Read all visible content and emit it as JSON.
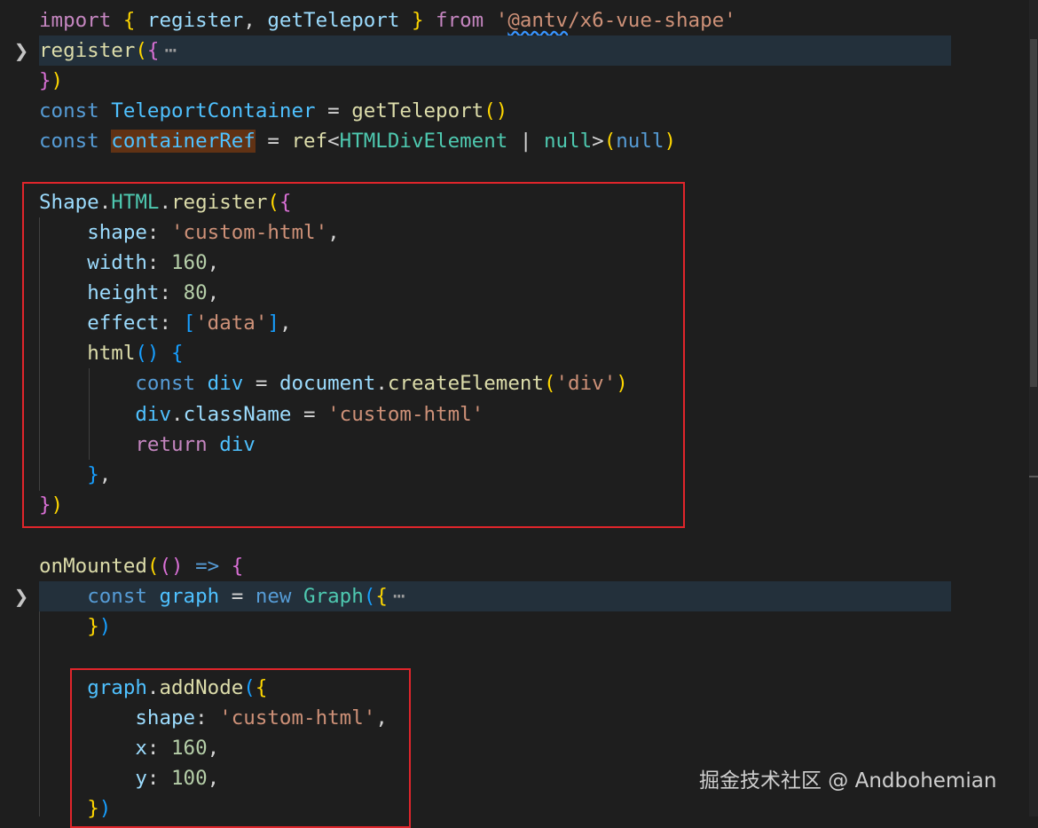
{
  "editor": {
    "fold_ellipsis": "⋯",
    "code_lines": [
      [
        {
          "t": "import",
          "c": "kw"
        },
        {
          "t": " "
        },
        {
          "t": "{",
          "c": "b1"
        },
        {
          "t": " "
        },
        {
          "t": "register",
          "c": "var"
        },
        {
          "t": ", "
        },
        {
          "t": "getTeleport",
          "c": "var"
        },
        {
          "t": " "
        },
        {
          "t": "}",
          "c": "b1"
        },
        {
          "t": " "
        },
        {
          "t": "from",
          "c": "kw"
        },
        {
          "t": " "
        },
        {
          "t": "'",
          "c": "str"
        },
        {
          "t": "@antv",
          "c": "str",
          "sq": true
        },
        {
          "t": "/x6-vue-shape'",
          "c": "str"
        }
      ],
      [
        {
          "t": "register",
          "c": "fn"
        },
        {
          "t": "(",
          "c": "b1"
        },
        {
          "t": "{",
          "c": "b2"
        }
      ],
      [
        {
          "t": "}",
          "c": "b2"
        },
        {
          "t": ")",
          "c": "b1"
        }
      ],
      [
        {
          "t": "const",
          "c": "kwb"
        },
        {
          "t": " "
        },
        {
          "t": "TeleportContainer",
          "c": "cst"
        },
        {
          "t": " = "
        },
        {
          "t": "getTeleport",
          "c": "fn"
        },
        {
          "t": "(",
          "c": "b1"
        },
        {
          "t": ")",
          "c": "b1"
        }
      ],
      [
        {
          "t": "const",
          "c": "kwb"
        },
        {
          "t": " "
        },
        {
          "t": "containerRef",
          "c": "cst",
          "sel": true
        },
        {
          "t": " = "
        },
        {
          "t": "ref",
          "c": "fn"
        },
        {
          "t": "<"
        },
        {
          "t": "HTMLDivElement",
          "c": "ty"
        },
        {
          "t": " | "
        },
        {
          "t": "null",
          "c": "ty"
        },
        {
          "t": ">"
        },
        {
          "t": "(",
          "c": "b1"
        },
        {
          "t": "null",
          "c": "kwb"
        },
        {
          "t": ")",
          "c": "b1"
        }
      ],
      [
        {
          "t": "Shape",
          "c": "var"
        },
        {
          "t": "."
        },
        {
          "t": "HTML",
          "c": "ty"
        },
        {
          "t": "."
        },
        {
          "t": "register",
          "c": "fn"
        },
        {
          "t": "(",
          "c": "b1"
        },
        {
          "t": "{",
          "c": "b2"
        }
      ],
      [
        {
          "t": "    "
        },
        {
          "t": "shape",
          "c": "var"
        },
        {
          "t": ": "
        },
        {
          "t": "'custom-html'",
          "c": "str"
        },
        {
          "t": ","
        }
      ],
      [
        {
          "t": "    "
        },
        {
          "t": "width",
          "c": "var"
        },
        {
          "t": ": "
        },
        {
          "t": "160",
          "c": "num"
        },
        {
          "t": ","
        }
      ],
      [
        {
          "t": "    "
        },
        {
          "t": "height",
          "c": "var"
        },
        {
          "t": ": "
        },
        {
          "t": "80",
          "c": "num"
        },
        {
          "t": ","
        }
      ],
      [
        {
          "t": "    "
        },
        {
          "t": "effect",
          "c": "var"
        },
        {
          "t": ": "
        },
        {
          "t": "[",
          "c": "b3"
        },
        {
          "t": "'data'",
          "c": "str"
        },
        {
          "t": "]",
          "c": "b3"
        },
        {
          "t": ","
        }
      ],
      [
        {
          "t": "    "
        },
        {
          "t": "html",
          "c": "fn"
        },
        {
          "t": "(",
          "c": "b3"
        },
        {
          "t": ")",
          "c": "b3"
        },
        {
          "t": " "
        },
        {
          "t": "{",
          "c": "b3"
        }
      ],
      [
        {
          "t": "        "
        },
        {
          "t": "const",
          "c": "kwb"
        },
        {
          "t": " "
        },
        {
          "t": "div",
          "c": "cst"
        },
        {
          "t": " = "
        },
        {
          "t": "document",
          "c": "var"
        },
        {
          "t": "."
        },
        {
          "t": "createElement",
          "c": "fn"
        },
        {
          "t": "(",
          "c": "b1"
        },
        {
          "t": "'div'",
          "c": "str"
        },
        {
          "t": ")",
          "c": "b1"
        }
      ],
      [
        {
          "t": "        "
        },
        {
          "t": "div",
          "c": "cst"
        },
        {
          "t": "."
        },
        {
          "t": "className",
          "c": "var"
        },
        {
          "t": " = "
        },
        {
          "t": "'custom-html'",
          "c": "str"
        }
      ],
      [
        {
          "t": "        "
        },
        {
          "t": "return",
          "c": "kw"
        },
        {
          "t": " "
        },
        {
          "t": "div",
          "c": "cst"
        }
      ],
      [
        {
          "t": "    "
        },
        {
          "t": "}",
          "c": "b3"
        },
        {
          "t": ","
        }
      ],
      [
        {
          "t": "}",
          "c": "b2"
        },
        {
          "t": ")",
          "c": "b1"
        }
      ],
      [
        {
          "t": "onMounted",
          "c": "fn"
        },
        {
          "t": "(",
          "c": "b1"
        },
        {
          "t": "(",
          "c": "b2"
        },
        {
          "t": ")",
          "c": "b2"
        },
        {
          "t": " "
        },
        {
          "t": "=>",
          "c": "kwb"
        },
        {
          "t": " "
        },
        {
          "t": "{",
          "c": "b2"
        }
      ],
      [
        {
          "t": "    "
        },
        {
          "t": "const",
          "c": "kwb"
        },
        {
          "t": " "
        },
        {
          "t": "graph",
          "c": "cst"
        },
        {
          "t": " = "
        },
        {
          "t": "new",
          "c": "kwb"
        },
        {
          "t": " "
        },
        {
          "t": "Graph",
          "c": "ty"
        },
        {
          "t": "(",
          "c": "b3"
        },
        {
          "t": "{",
          "c": "b1"
        }
      ],
      [
        {
          "t": "    "
        },
        {
          "t": "}",
          "c": "b1"
        },
        {
          "t": ")",
          "c": "b3"
        }
      ],
      [
        {
          "t": "    "
        },
        {
          "t": "graph",
          "c": "cst"
        },
        {
          "t": "."
        },
        {
          "t": "addNode",
          "c": "fn"
        },
        {
          "t": "(",
          "c": "b3"
        },
        {
          "t": "{",
          "c": "b1"
        }
      ],
      [
        {
          "t": "        "
        },
        {
          "t": "shape",
          "c": "var"
        },
        {
          "t": ": "
        },
        {
          "t": "'custom-html'",
          "c": "str"
        },
        {
          "t": ","
        }
      ],
      [
        {
          "t": "        "
        },
        {
          "t": "x",
          "c": "var"
        },
        {
          "t": ": "
        },
        {
          "t": "160",
          "c": "num"
        },
        {
          "t": ","
        }
      ],
      [
        {
          "t": "        "
        },
        {
          "t": "y",
          "c": "var"
        },
        {
          "t": ": "
        },
        {
          "t": "100",
          "c": "num"
        },
        {
          "t": ","
        }
      ],
      [
        {
          "t": "    "
        },
        {
          "t": "}",
          "c": "b1"
        },
        {
          "t": ")",
          "c": "b3"
        }
      ]
    ]
  },
  "watermark": "掘金技术社区 @ Andbohemian"
}
